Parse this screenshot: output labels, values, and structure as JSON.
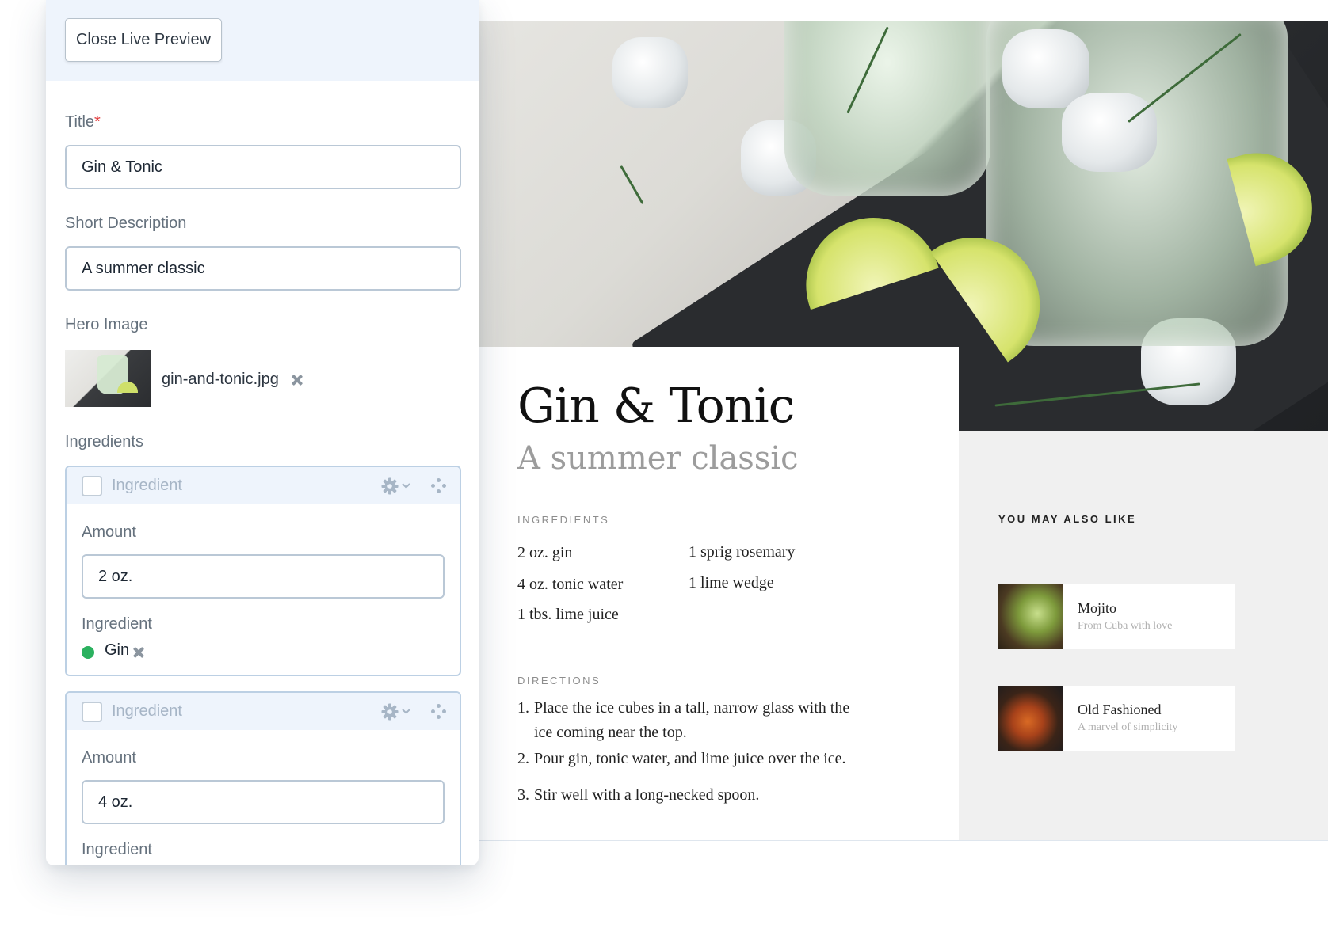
{
  "editor": {
    "close_button": "Close Live Preview",
    "title_label": "Title",
    "required_mark": "*",
    "title_value": "Gin & Tonic",
    "short_desc_label": "Short Description",
    "short_desc_value": "A summer classic",
    "hero_label": "Hero Image",
    "hero_file": "gin-and-tonic.jpg",
    "ingredients_label": "Ingredients",
    "blocks": [
      {
        "title": "Ingredient",
        "amount_label": "Amount",
        "amount_value": "2 oz.",
        "ingredient_label": "Ingredient",
        "ingredient_value": "Gin",
        "status_color": "#2bb15f"
      },
      {
        "title": "Ingredient",
        "amount_label": "Amount",
        "amount_value": "4 oz.",
        "ingredient_label": "Ingredient"
      }
    ]
  },
  "preview": {
    "title": "Gin & Tonic",
    "subtitle": "A summer classic",
    "ingredients_heading": "INGREDIENTS",
    "ingredients_col1": [
      "2 oz. gin",
      "4 oz. tonic water",
      "1 tbs. lime juice"
    ],
    "ingredients_col2": [
      "1 sprig rosemary",
      "1 lime wedge"
    ],
    "directions_heading": "DIRECTIONS",
    "directions": [
      {
        "num": "1.",
        "text": "Place the ice cubes in a tall, narrow glass with the ice coming near the top."
      },
      {
        "num": "2.",
        "text": "Pour gin, tonic water, and lime juice over the ice."
      },
      {
        "num": "3.",
        "text": "Stir well with a long-necked spoon."
      }
    ],
    "also_like_heading": "YOU MAY ALSO LIKE",
    "related": [
      {
        "name": "Mojito",
        "desc": "From Cuba with love"
      },
      {
        "name": "Old Fashioned",
        "desc": "A marvel of simplicity"
      }
    ]
  },
  "colors": {
    "accent_panel": "#eef4fc",
    "field_border": "#bac8d6",
    "required": "#e2393a",
    "status_published": "#2bb15f",
    "preview_sidebar": "#f0f0f0"
  }
}
